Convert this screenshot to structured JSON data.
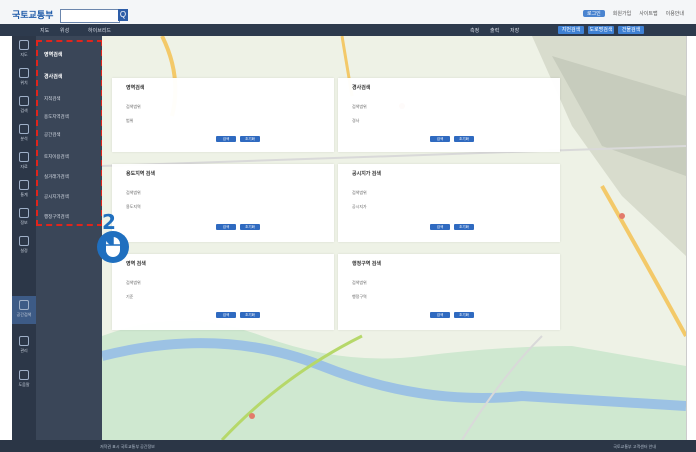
{
  "header": {
    "logo": "국토교통부",
    "search_placeholder": "",
    "search_button": "Q",
    "links": [
      "로그인",
      "회원가입",
      "사이트맵"
    ],
    "active_pill": "로그인",
    "help_link": "이용안내"
  },
  "toolbar": {
    "items": [
      "지도",
      "위성",
      "하이브리드"
    ],
    "right_items": [
      "측정",
      "출력",
      "저장"
    ],
    "buttons": [
      "지번검색",
      "도로명검색",
      "건물검색"
    ]
  },
  "left_rail": {
    "items": [
      "지도",
      "위치",
      "검색",
      "분석",
      "자료",
      "통계",
      "정보",
      "설정",
      "공간검색",
      "관리",
      "도움말"
    ]
  },
  "submenu": {
    "items": [
      "영역검색",
      "경사검색",
      "지적검색",
      "용도지역검색",
      "공간검색",
      "토지이용검색",
      "실거래가검색",
      "공시지가검색",
      "행정구역검색"
    ]
  },
  "cards": [
    {
      "title": "영역검색",
      "rows": [
        "검색범위",
        "범위"
      ],
      "buttons": [
        "검색",
        "초기화"
      ]
    },
    {
      "title": "경사검색",
      "rows": [
        "검색범위",
        "경사"
      ],
      "buttons": [
        "검색",
        "초기화"
      ]
    },
    {
      "title": "용도지역 검색",
      "rows": [
        "검색범위",
        "용도지역"
      ],
      "buttons": [
        "검색",
        "초기화"
      ]
    },
    {
      "title": "공시지가 검색",
      "rows": [
        "검색범위",
        "공시지가"
      ],
      "buttons": [
        "검색",
        "초기화"
      ]
    },
    {
      "title": "영역 검색",
      "rows": [
        "검색범위",
        "기준"
      ],
      "buttons": [
        "검색",
        "초기화"
      ]
    },
    {
      "title": "행정구역 검색",
      "rows": [
        "검색범위",
        "행정구역"
      ],
      "buttons": [
        "검색",
        "초기화"
      ]
    }
  ],
  "step_number": "2",
  "bottombar": {
    "left": "저작권 표시 국토교통부 공간정보",
    "right": "국토교통부 고객센터 안내"
  },
  "colors": {
    "accent": "#2f6ac0",
    "highlight": "#e0241b",
    "sidebar": "#2c3748"
  }
}
